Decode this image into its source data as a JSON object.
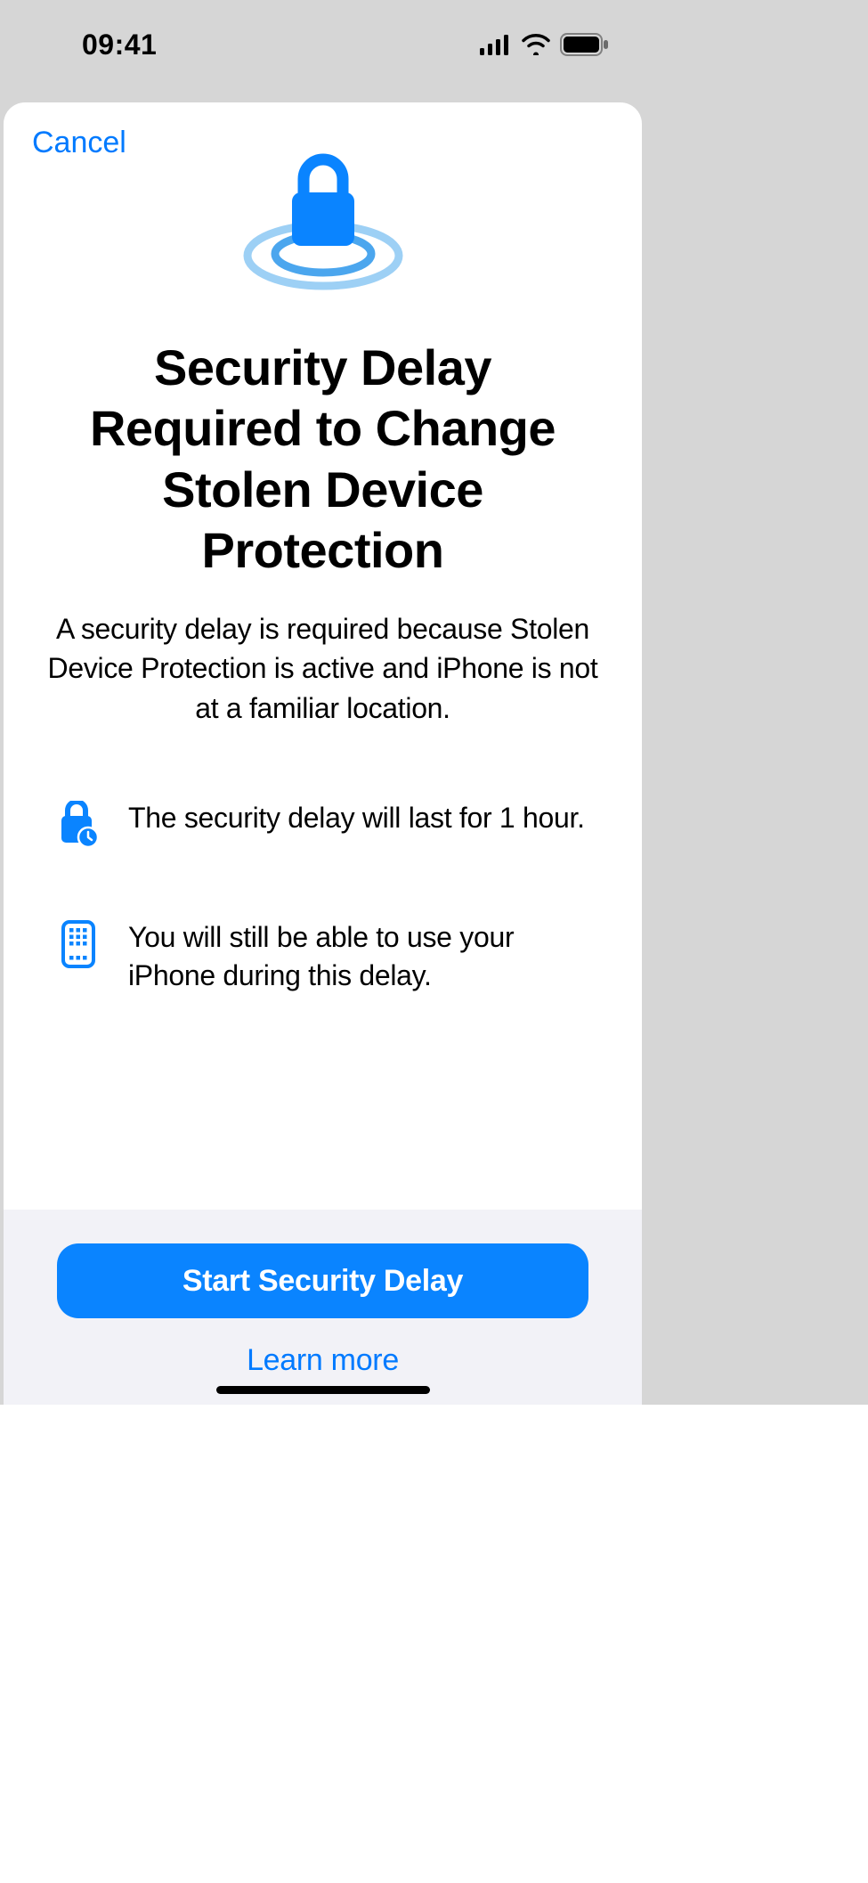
{
  "statusBar": {
    "time": "09:41"
  },
  "sheet": {
    "cancel": "Cancel",
    "title": "Security Delay Required to Change Stolen Device Protection",
    "subtitle": "A security delay is required because Stolen Device Protection is active and iPhone is not at a familiar location.",
    "features": [
      {
        "text": "The security delay will last for 1 hour."
      },
      {
        "text": "You will still be able to use your iPhone during this delay."
      }
    ],
    "primaryButton": "Start Security Delay",
    "secondaryLink": "Learn more"
  }
}
